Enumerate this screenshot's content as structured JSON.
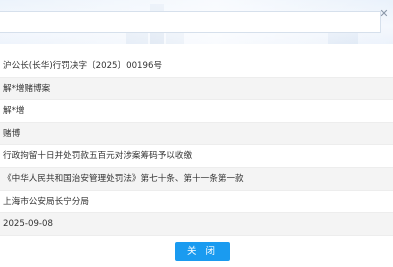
{
  "record": {
    "decision_number": "沪公长(长华)行罚决字〔2025〕00196号",
    "case_name": "解*增赌博案",
    "person_name": "解*增",
    "violation": "赌博",
    "penalty": "行政拘留十日并处罚款五百元对涉案筹码予以收缴",
    "legal_basis": "《中华人民共和国治安管理处罚法》第七十条、第十一条第一款",
    "authority": "上海市公安局长宁分局",
    "decision_date": "2025-09-08"
  },
  "footer": {
    "close_label": "关 闭"
  },
  "icons": {
    "banner_close": "close-icon"
  },
  "colors": {
    "accent": "#1a9bf0",
    "row_alt": "#f4f4f4",
    "text": "#333333"
  }
}
